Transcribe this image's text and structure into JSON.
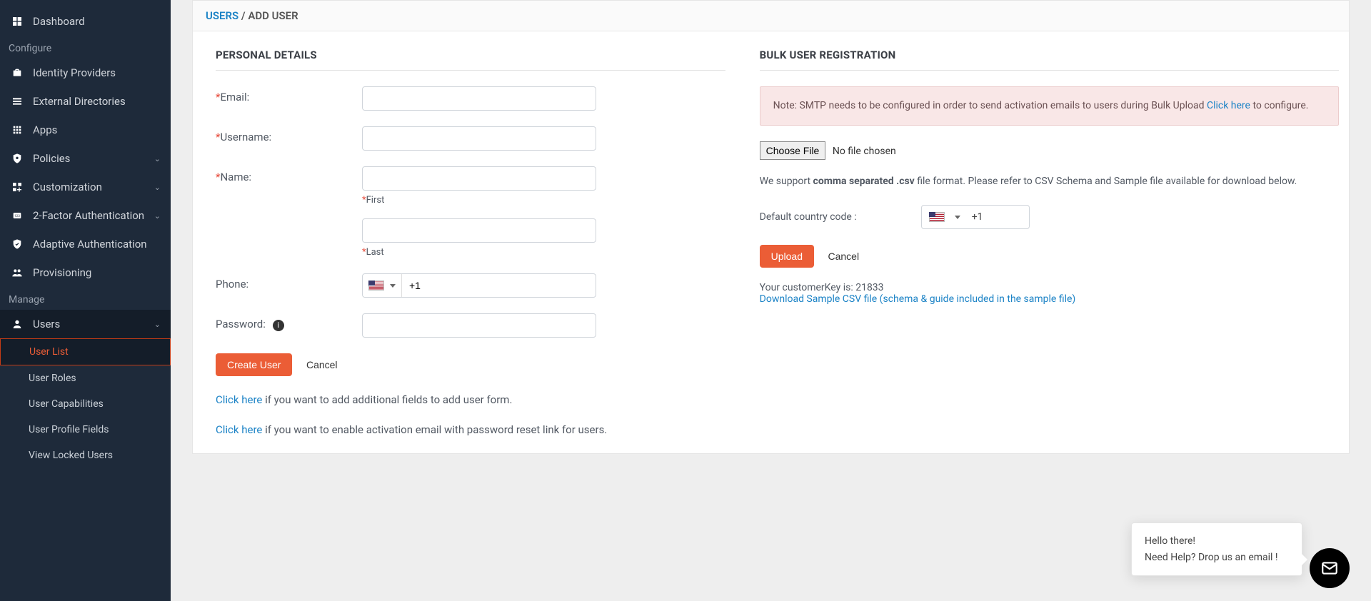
{
  "sidebar": {
    "dashboard": "Dashboard",
    "configure": "Configure",
    "identity_providers": "Identity Providers",
    "external_directories": "External Directories",
    "apps": "Apps",
    "policies": "Policies",
    "customization": "Customization",
    "two_factor": "2-Factor Authentication",
    "adaptive": "Adaptive Authentication",
    "provisioning": "Provisioning",
    "manage": "Manage",
    "users": "Users",
    "user_list": "User List",
    "user_roles": "User Roles",
    "user_capabilities": "User Capabilities",
    "user_profile_fields": "User Profile Fields",
    "view_locked_users": "View Locked Users"
  },
  "breadcrumb": {
    "users": "USERS",
    "sep": " / ",
    "add_user": "ADD USER"
  },
  "personal": {
    "title": "PERSONAL DETAILS",
    "email": "Email:",
    "username": "Username:",
    "name": "Name:",
    "first": "First",
    "last": "Last",
    "phone": "Phone:",
    "phone_code": "+1",
    "password": "Password:",
    "create_user_btn": "Create User",
    "cancel_btn": "Cancel",
    "hint1_link": "Click here",
    "hint1_rest": " if you want to add additional fields to add user form.",
    "hint2_link": "Click here",
    "hint2_rest": " if you want to enable activation email with password reset link for users."
  },
  "bulk": {
    "title": "BULK USER REGISTRATION",
    "alert_prefix": "Note: SMTP needs to be configured in order to send activation emails to users during Bulk Upload ",
    "alert_link": "Click here",
    "alert_suffix": " to configure.",
    "choose_file": "Choose File",
    "no_file": "No file chosen",
    "support_prefix": "We support ",
    "support_strong": "comma separated .csv",
    "support_suffix": " file format. Please refer to CSV Schema and Sample file available for download below.",
    "default_country": "Default country code :",
    "country_code": "+1",
    "upload_btn": "Upload",
    "cancel_btn": "Cancel",
    "customer_key_label": "Your customerKey is: ",
    "customer_key_value": "21833",
    "download_link": "Download Sample CSV file (schema & guide included in the sample file)"
  },
  "chat": {
    "line1": "Hello there!",
    "line2": "Need Help? Drop us an email !"
  }
}
